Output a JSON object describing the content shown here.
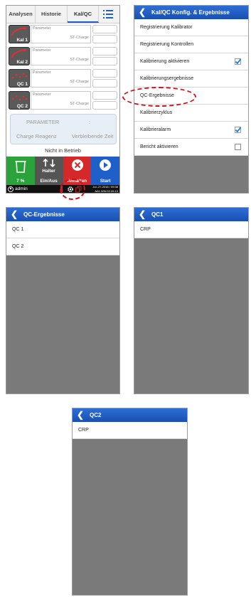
{
  "panel1": {
    "tabs": [
      "Analysen",
      "Historie",
      "Kal/QC"
    ],
    "menu_icon": "list-icon",
    "cal_rows": [
      {
        "button_label": "Kal 1",
        "param_label": "Parameter",
        "charge_label": "ST-Charge"
      },
      {
        "button_label": "Kal 2",
        "param_label": "Parameter",
        "charge_label": "ST-Charge"
      },
      {
        "button_label": "QC 1",
        "param_label": "Parameter",
        "charge_label": "ST-Charge"
      },
      {
        "button_label": "QC 2",
        "param_label": "Parameter",
        "charge_label": "ST-Charge"
      }
    ],
    "info": {
      "parameter_label": "PARAMETER",
      "colon": ":",
      "charge_label": "Charge Reagenz",
      "remaining_label": "Verbleibende Zeit"
    },
    "status": "Nicht in Betrieb",
    "buttons": {
      "waste_value": "7 %",
      "holder_label_1": "Halter",
      "holder_label_2": "Ein/Aus",
      "stop_label": "Anhalten",
      "start_label": "Start"
    },
    "statusbar": {
      "user": "admin",
      "datetime": "Jul.-27-2018 / 09:38",
      "version": "AA1.WW.02.06.13"
    },
    "colors": {
      "green": "#2aa33a",
      "gray_button": "#555555",
      "red": "#d62828",
      "blue": "#1f5fc9"
    }
  },
  "panel2": {
    "title": "Kal/QC Konfig. & Ergebnisse",
    "items": [
      {
        "label": "Registrierung Kalibrator",
        "checkbox": null
      },
      {
        "label": "Registrierung Kontrollen",
        "checkbox": null
      },
      {
        "label": "Kalibrierung aktivieren",
        "checkbox": true
      },
      {
        "label": "Kalibrierungsergebnisse",
        "checkbox": null
      },
      {
        "label": "QC-Ergebnisse",
        "checkbox": null
      },
      {
        "label": "Kalibrierzyklus",
        "checkbox": null
      },
      {
        "label": "Kalibrieralarm",
        "checkbox": true
      },
      {
        "label": "Bericht aktivieren",
        "checkbox": false
      }
    ]
  },
  "panel3": {
    "title": "QC-Ergebnisse",
    "items": [
      "QC 1",
      "QC 2"
    ]
  },
  "panel4": {
    "title": "QC1",
    "items": [
      "CRP"
    ]
  },
  "panel5": {
    "title": "QC2",
    "items": [
      "CRP"
    ]
  },
  "back_icon": "chevron-left-icon",
  "highlight_color": "#d3101a"
}
